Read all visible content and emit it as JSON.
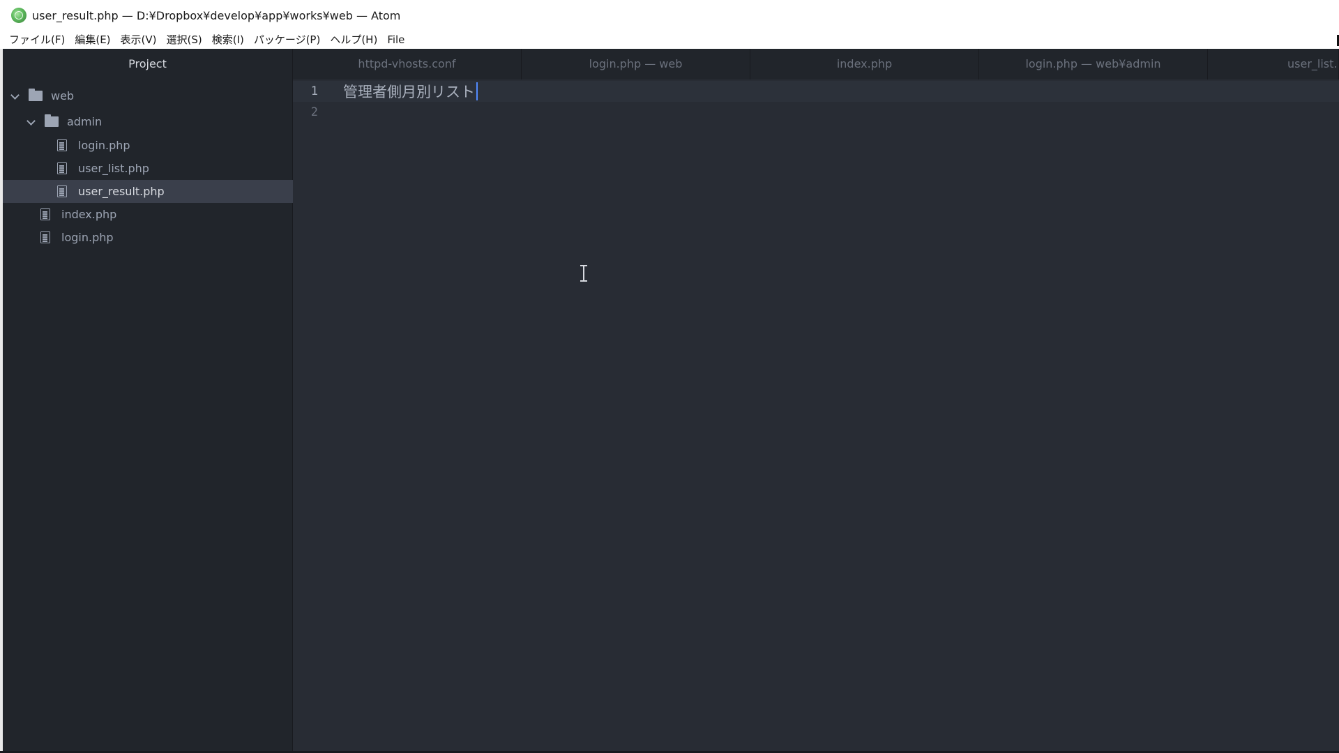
{
  "window": {
    "title": "user_result.php — D:¥Dropbox¥develop¥app¥works¥web — Atom"
  },
  "menu": {
    "items": [
      {
        "label": "ファイル(F)"
      },
      {
        "label": "編集(E)"
      },
      {
        "label": "表示(V)"
      },
      {
        "label": "選択(S)"
      },
      {
        "label": "検索(I)"
      },
      {
        "label": "パッケージ(P)"
      },
      {
        "label": "ヘルプ(H)"
      },
      {
        "label": "File"
      }
    ]
  },
  "tree": {
    "header": "Project",
    "items": [
      {
        "label": "web",
        "type": "folder",
        "expanded": true,
        "icon": "folder-icon"
      },
      {
        "label": "admin",
        "type": "folder",
        "expanded": true,
        "icon": "folder-icon"
      },
      {
        "label": "login.php",
        "type": "file",
        "icon": "file-icon"
      },
      {
        "label": "user_list.php",
        "type": "file",
        "icon": "file-icon"
      },
      {
        "label": "user_result.php",
        "type": "file",
        "selected": true,
        "icon": "file-icon"
      },
      {
        "label": "index.php",
        "type": "file",
        "icon": "file-icon"
      },
      {
        "label": "login.php",
        "type": "file",
        "icon": "file-icon"
      }
    ]
  },
  "tabs": [
    {
      "label": "httpd-vhosts.conf"
    },
    {
      "label": "login.php — web"
    },
    {
      "label": "index.php"
    },
    {
      "label": "login.php — web¥admin"
    },
    {
      "label": "user_list.p"
    }
  ],
  "editor": {
    "lines": [
      {
        "number": "1",
        "text": "管理者側月別リスト",
        "current": true
      },
      {
        "number": "2",
        "text": "",
        "current": false
      }
    ]
  },
  "colors": {
    "editor_bg": "#282c34",
    "panel_bg": "#21252b",
    "selection_bg": "#3a3f4b",
    "cursor": "#528bff",
    "text": "#abb2bf",
    "muted_text": "#9da5b4"
  }
}
